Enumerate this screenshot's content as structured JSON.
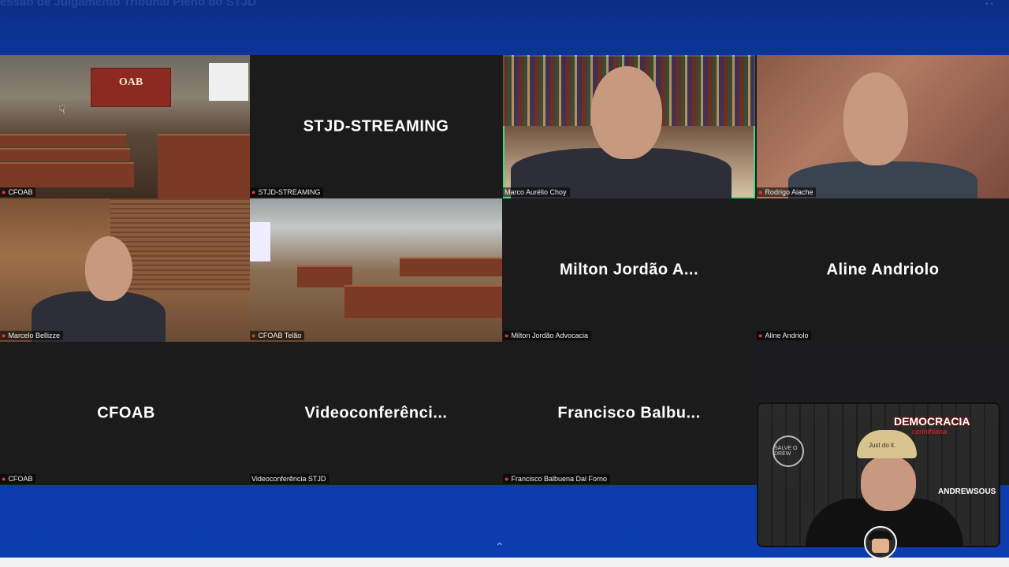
{
  "window": {
    "title": "essão de Julgamento Tribunal Pleno do STJD"
  },
  "tiles": [
    {
      "id": "t1",
      "label": "CFOAB",
      "display_name": "",
      "active": false
    },
    {
      "id": "t2",
      "label": "STJD-STREAMING",
      "display_name": "STJD-STREAMING",
      "active": false
    },
    {
      "id": "t3",
      "label": "Marco Aurélio Choy",
      "display_name": "",
      "active": true
    },
    {
      "id": "t4",
      "label": "Rodrigo Aiache",
      "display_name": "",
      "active": false
    },
    {
      "id": "t5",
      "label": "Marcelo Bellizze",
      "display_name": "",
      "active": false
    },
    {
      "id": "t6",
      "label": "CFOAB Telão",
      "display_name": "",
      "active": false
    },
    {
      "id": "t7",
      "label": "Milton Jordão Advocacia",
      "display_name": "Milton Jordão A...",
      "active": false
    },
    {
      "id": "t8",
      "label": "Aline Andriolo",
      "display_name": "Aline Andriolo",
      "active": false
    },
    {
      "id": "t9",
      "label": "CFOAB",
      "display_name": "CFOAB",
      "active": false
    },
    {
      "id": "t10",
      "label": "Videoconferência STJD",
      "display_name": "Videoconferênci...",
      "active": false
    },
    {
      "id": "t11",
      "label": "Francisco Balbuena Dal Forno",
      "display_name": "Francisco Balbu...",
      "active": false
    }
  ],
  "overlay": {
    "banner": "DEMOCRACIA",
    "banner_sub": "corinthiana",
    "handle": "ANDREWSOUS",
    "cap_text": "Just do it.",
    "badge_text": "SALVE O DREW"
  },
  "scene_text": {
    "oab_sign": "OAB"
  },
  "icons": {
    "mic_muted": "mic-muted-icon",
    "cursor": "hand-cursor-icon",
    "chevron": "chevron-up-icon"
  },
  "colors": {
    "active_border": "#3ddc84",
    "background_blue": "#0b3aa6",
    "muted_mic": "#ee3333"
  }
}
